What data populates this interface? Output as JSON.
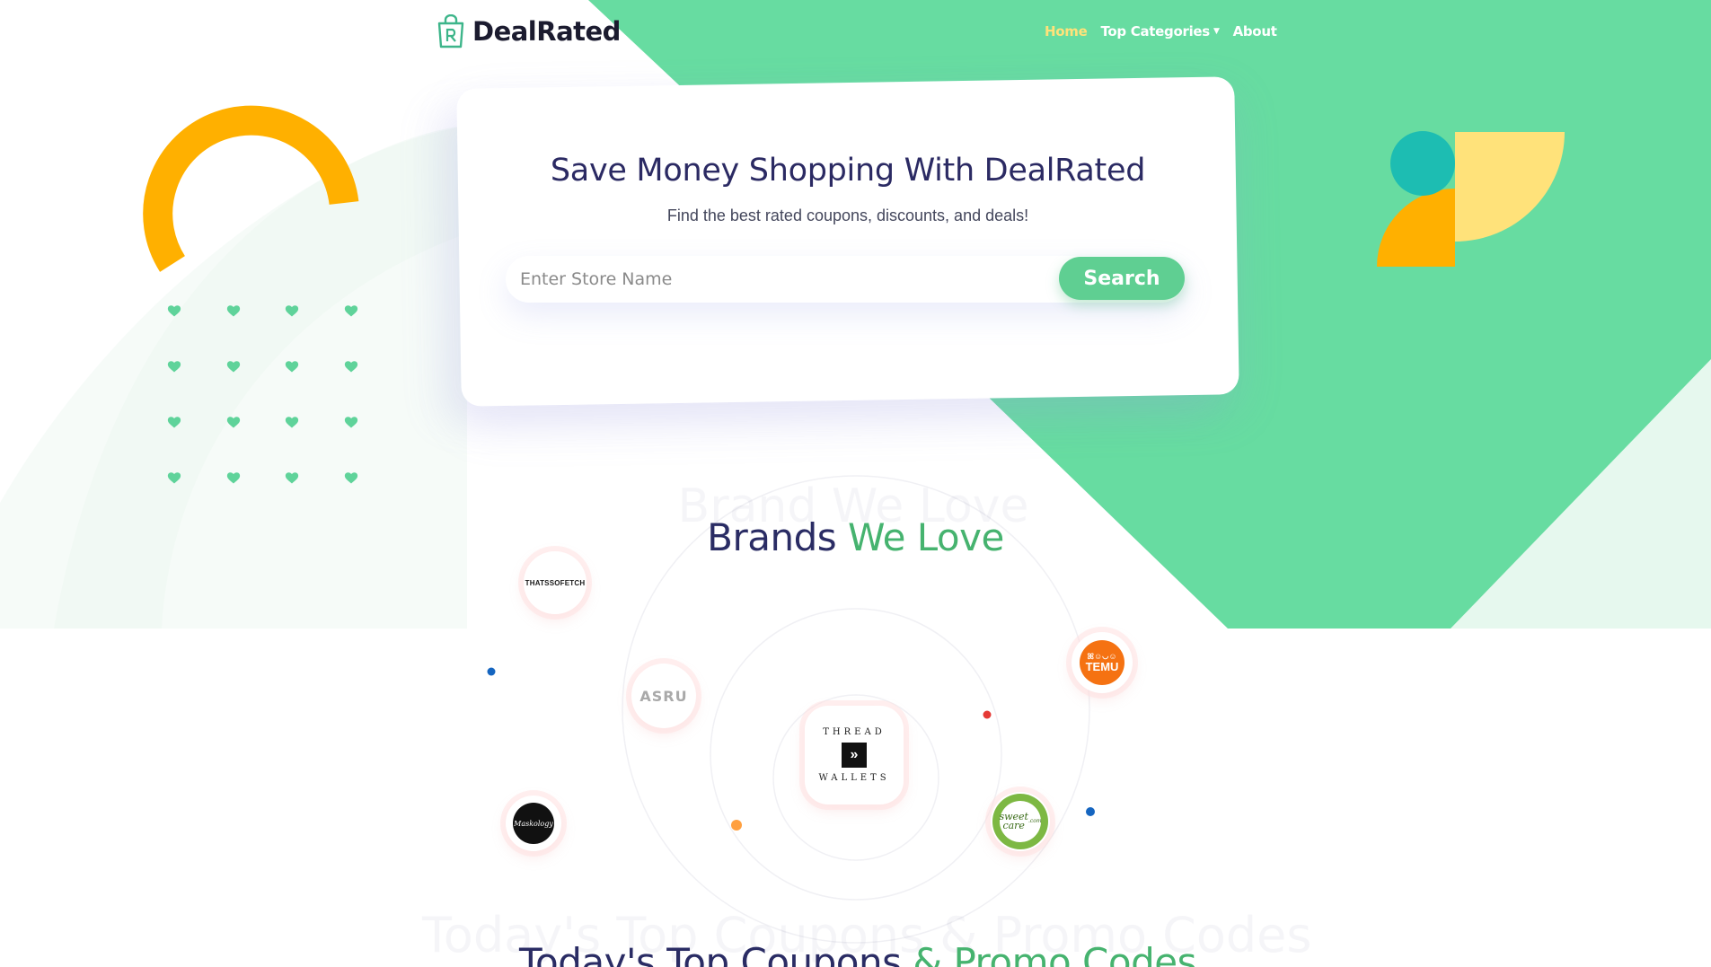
{
  "brand": {
    "name": "DealRated"
  },
  "nav": {
    "items": [
      {
        "label": "Home",
        "active": true
      },
      {
        "label": "Top Categories",
        "dropdown": true
      },
      {
        "label": "About"
      }
    ]
  },
  "hero": {
    "title": "Save Money Shopping With DealRated",
    "subtitle": "Find the best rated coupons, discounts, and deals!",
    "search": {
      "placeholder": "Enter Store Name",
      "value": "",
      "button_label": "Search"
    }
  },
  "brands_section": {
    "ghost_title": "Brand We Love",
    "title_main": "Brands",
    "title_accent": "We Love",
    "brands": [
      {
        "name": "THATSSOFETCH"
      },
      {
        "name": "ASRU"
      },
      {
        "name": "TEMU",
        "glyphs": "ꕤ☺◡☺"
      },
      {
        "name_top": "THREAD",
        "name_bottom": "WALLETS",
        "mark": "»"
      },
      {
        "name": "Maskology"
      },
      {
        "name": "sweet care",
        "suffix": ".com"
      }
    ]
  },
  "coupons_section": {
    "ghost_title": "Today's Top Coupons & Promo Codes",
    "title_main": "Today's Top Coupons",
    "title_accent": "& Promo Codes"
  },
  "colors": {
    "green": "#67dca1",
    "accent_green": "#46b36f",
    "navy": "#2a2c64",
    "yellow": "#ffb000",
    "light_yellow": "#ffe27a",
    "teal": "#1dbdb2",
    "temu_orange": "#f57212"
  }
}
